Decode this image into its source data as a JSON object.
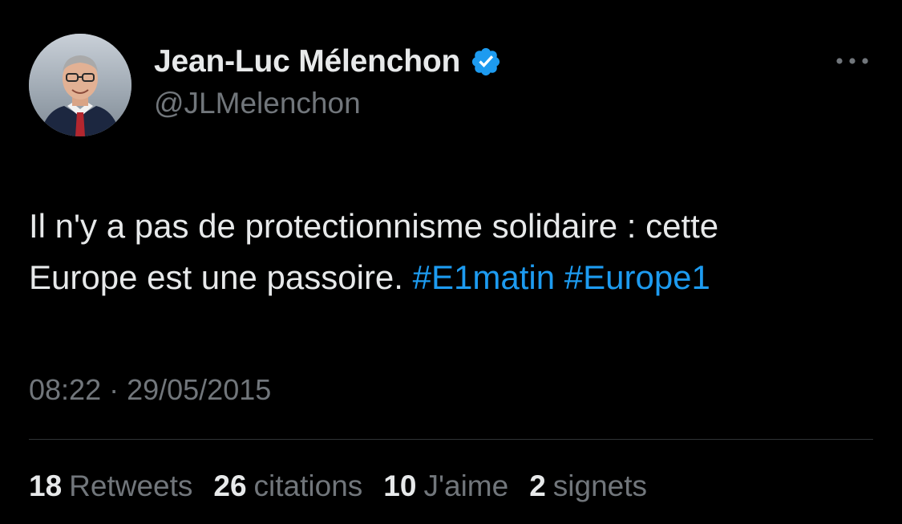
{
  "author": {
    "display_name": "Jean-Luc Mélenchon",
    "handle": "@JLMelenchon",
    "verified_icon": "verified-badge-icon",
    "avatar_icon": "profile-photo"
  },
  "menu": {
    "more_icon": "more-horizontal-icon"
  },
  "tweet": {
    "line1": "Il n'y a pas de protectionnisme solidaire : cette",
    "line2_text": "Europe est une passoire.",
    "hashtags": [
      "#E1matin",
      "#Europe1"
    ],
    "timestamp": "08:22 · 29/05/2015"
  },
  "stats": [
    {
      "count": "18",
      "label": "Retweets"
    },
    {
      "count": "26",
      "label": "citations"
    },
    {
      "count": "10",
      "label": "J'aime"
    },
    {
      "count": "2",
      "label": "signets"
    }
  ],
  "colors": {
    "background": "#000000",
    "text": "#e7e9ea",
    "secondary": "#71767b",
    "accent": "#1d9bf0",
    "divider": "#2f3336"
  }
}
